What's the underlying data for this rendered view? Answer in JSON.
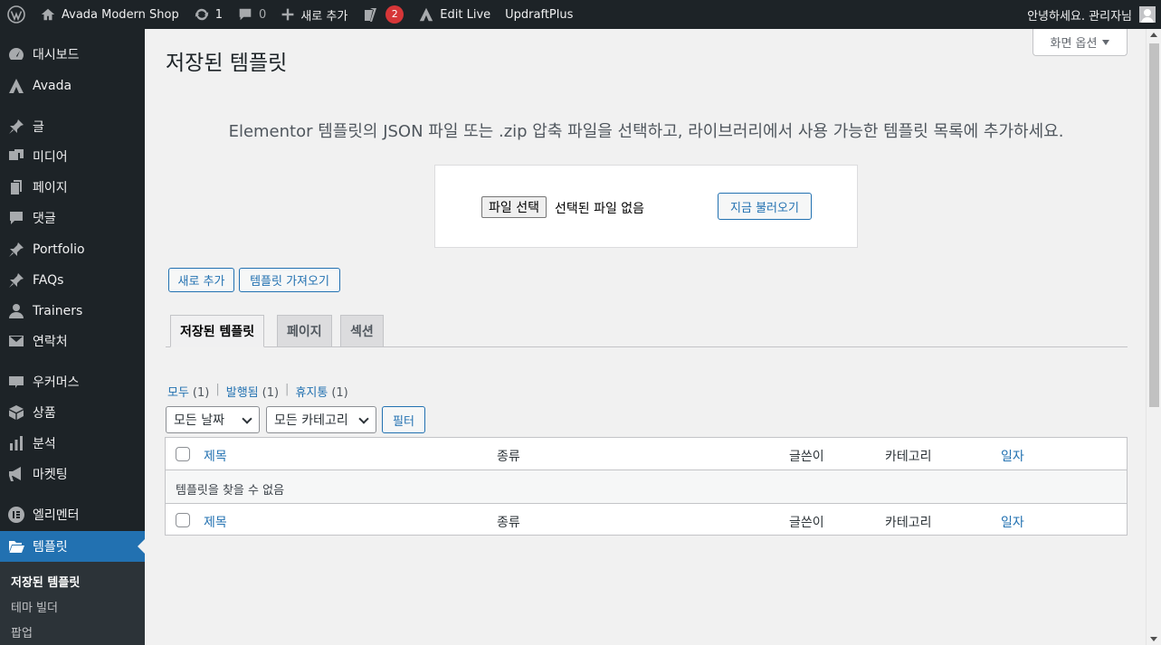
{
  "adminbar": {
    "site_name": "Avada Modern Shop",
    "updates_count": "1",
    "comments_count": "0",
    "new_label": "새로 추가",
    "yoast_badge": "2",
    "edit_live": "Edit Live",
    "updraft": "UpdraftPlus",
    "greeting": "안녕하세요. 관리자님"
  },
  "sidebar": {
    "items": [
      {
        "label": "대시보드",
        "icon": "dashboard-icon"
      },
      {
        "label": "Avada",
        "icon": "avada-icon"
      },
      {
        "label": "글",
        "icon": "pin-icon"
      },
      {
        "label": "미디어",
        "icon": "media-icon"
      },
      {
        "label": "페이지",
        "icon": "page-icon"
      },
      {
        "label": "댓글",
        "icon": "comment-icon"
      },
      {
        "label": "Portfolio",
        "icon": "pin-icon"
      },
      {
        "label": "FAQs",
        "icon": "pin-icon"
      },
      {
        "label": "Trainers",
        "icon": "user-icon"
      },
      {
        "label": "연락처",
        "icon": "mail-icon"
      },
      {
        "label": "우커머스",
        "icon": "woo-icon"
      },
      {
        "label": "상품",
        "icon": "box-icon"
      },
      {
        "label": "분석",
        "icon": "chart-icon"
      },
      {
        "label": "마켓팅",
        "icon": "megaphone-icon"
      },
      {
        "label": "엘리멘터",
        "icon": "elementor-icon"
      },
      {
        "label": "템플릿",
        "icon": "folder-icon"
      }
    ],
    "submenu": [
      "저장된 템플릿",
      "테마 빌더",
      "팝업"
    ]
  },
  "screen_options": "화면 옵션",
  "page_title": "저장된 템플릿",
  "import": {
    "description": "Elementor 템플릿의 JSON 파일 또는 .zip 압축 파일을 선택하고, 라이브러리에서 사용 가능한 템플릿 목록에 추가하세요.",
    "file_button": "파일 선택",
    "file_status": "선택된 파일 없음",
    "import_now": "지금 불러오기"
  },
  "actions": {
    "add_new": "새로 추가",
    "import_templates": "템플릿 가져오기"
  },
  "tabs": [
    "저장된 템플릿",
    "페이지",
    "섹션"
  ],
  "views": [
    {
      "label": "모두",
      "count": "(1)"
    },
    {
      "label": "발행됨",
      "count": "(1)"
    },
    {
      "label": "휴지통",
      "count": "(1)"
    }
  ],
  "filters": {
    "date": "모든 날짜",
    "category": "모든 카테고리",
    "filter_button": "필터"
  },
  "table": {
    "columns": [
      "제목",
      "종류",
      "글쓴이",
      "카테고리",
      "일자"
    ],
    "empty_message": "템플릿을 찾을 수 없음"
  },
  "colors": {
    "accent": "#2271b1",
    "adminbar": "#1d2327",
    "badge": "#d63638"
  }
}
